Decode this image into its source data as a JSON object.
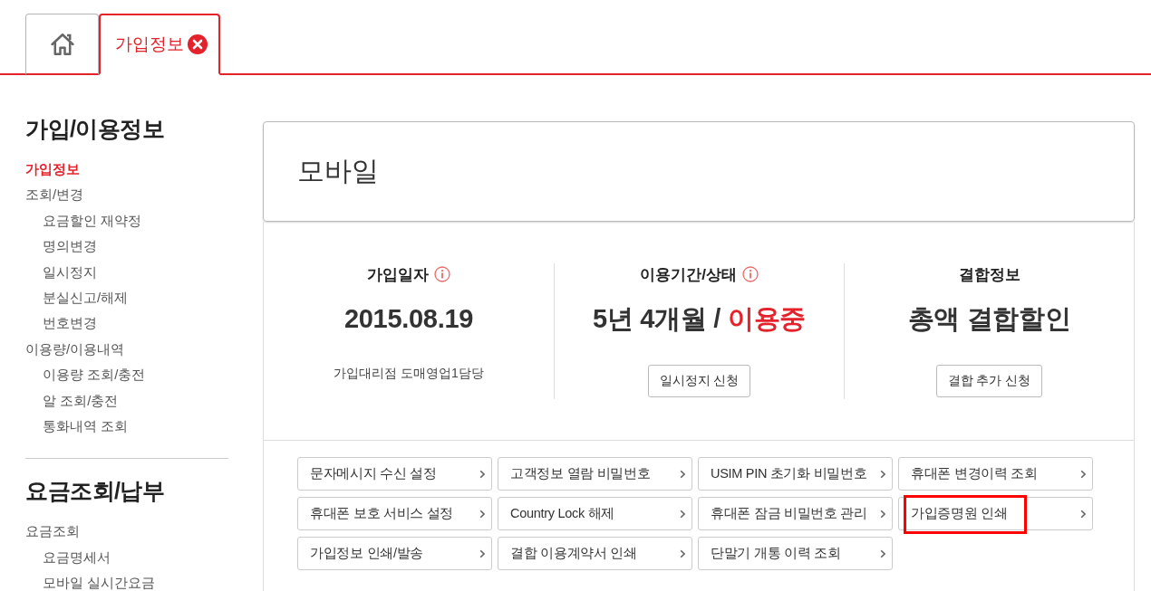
{
  "tabs": [
    {
      "kind": "home",
      "selected": false
    },
    {
      "kind": "page",
      "label": "가입정보",
      "selected": true,
      "closable": true
    }
  ],
  "sidebar": {
    "sections": [
      {
        "title": "가입/이용정보",
        "items": [
          {
            "label": "가입정보",
            "selected": true
          },
          {
            "label": "조회/변경",
            "selected": false,
            "children": [
              {
                "label": "요금할인 재약정",
                "selected": false
              },
              {
                "label": "명의변경",
                "selected": false
              },
              {
                "label": "일시정지",
                "selected": false
              },
              {
                "label": "분실신고/해제",
                "selected": false
              },
              {
                "label": "번호변경",
                "selected": false
              }
            ]
          },
          {
            "label": "이용량/이용내역",
            "selected": false,
            "children": [
              {
                "label": "이용량 조회/충전",
                "selected": false
              },
              {
                "label": "알 조회/충전",
                "selected": false
              },
              {
                "label": "통화내역 조회",
                "selected": false
              }
            ]
          }
        ]
      },
      {
        "title": "요금조회/납부",
        "items": [
          {
            "label": "요금조회",
            "selected": false,
            "children": [
              {
                "label": "요금명세서",
                "selected": false
              },
              {
                "label": "모바일 실시간요금",
                "selected": false
              }
            ]
          }
        ]
      }
    ]
  },
  "panel": {
    "title": "모바일"
  },
  "summary": [
    {
      "title": "가입일자",
      "info_icon": true,
      "value": "2015.08.19",
      "footer": {
        "kind": "note",
        "text": "가입대리점 도매영업1담당"
      }
    },
    {
      "title": "이용기간/상태",
      "info_icon": true,
      "value": "5년 4개월 /",
      "status": "이용중",
      "footer": {
        "kind": "button",
        "text": "일시정지 신청"
      }
    },
    {
      "title": "결합정보",
      "info_icon": false,
      "value": "총액 결합할인",
      "footer": {
        "kind": "button",
        "text": "결합 추가 신청"
      }
    }
  ],
  "menu": [
    {
      "label": "문자메시지 수신 설정",
      "highlighted": false
    },
    {
      "label": "고객정보 열람 비밀번호",
      "highlighted": false
    },
    {
      "label": "USIM PIN 초기화 비밀번호",
      "highlighted": false
    },
    {
      "label": "휴대폰 변경이력 조회",
      "highlighted": false
    },
    {
      "label": "휴대폰 보호 서비스 설정",
      "highlighted": false
    },
    {
      "label": "Country Lock 해제",
      "highlighted": false
    },
    {
      "label": "휴대폰 잠금 비밀번호 관리",
      "highlighted": false
    },
    {
      "label": "가입증명원 인쇄",
      "highlighted": true
    },
    {
      "label": "가입정보 인쇄/발송",
      "highlighted": false
    },
    {
      "label": "결합 이용계약서 인쇄",
      "highlighted": false
    },
    {
      "label": "단말기 개통 이력 조회",
      "highlighted": false
    }
  ]
}
